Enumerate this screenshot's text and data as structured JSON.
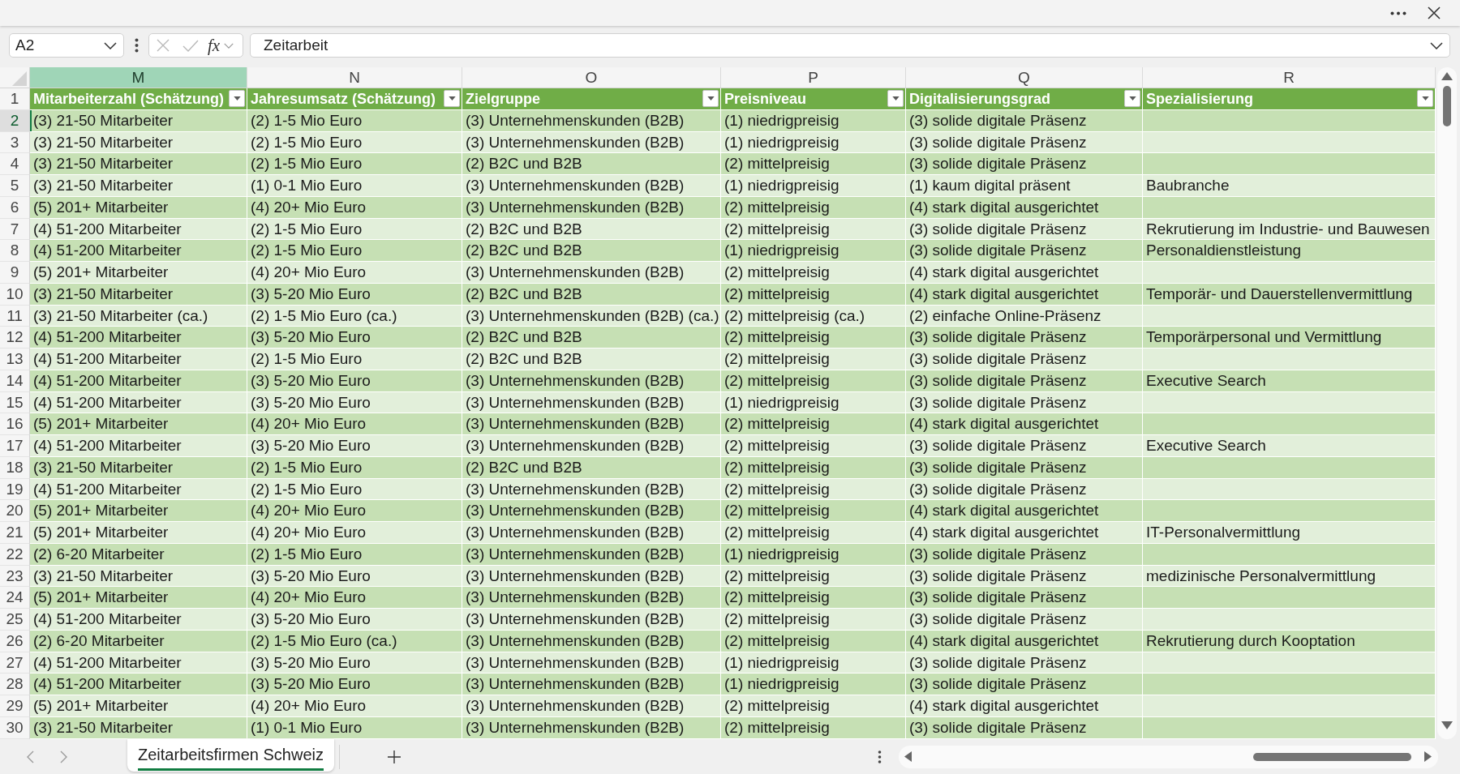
{
  "formula_bar": {
    "name_box": "A2",
    "editing": false,
    "function_label": "fx",
    "formula": "Zeitarbeit"
  },
  "sheet": {
    "columns": [
      {
        "letter": "M",
        "selected": true
      },
      {
        "letter": "N",
        "selected": false
      },
      {
        "letter": "O",
        "selected": false
      },
      {
        "letter": "P",
        "selected": false
      },
      {
        "letter": "Q",
        "selected": false
      },
      {
        "letter": "R",
        "selected": false
      }
    ],
    "rows": [
      {
        "number": "1",
        "kind": "header",
        "selected": false,
        "cells": [
          "Mitarbeiterzahl (Schätzung)",
          "Jahresumsatz (Schätzung)",
          "Zielgruppe",
          "Preisniveau",
          "Digitalisierungsgrad",
          "Spezialisierung"
        ]
      },
      {
        "number": "2",
        "kind": "data",
        "selected": true,
        "cells": [
          "(3) 21-50 Mitarbeiter",
          "(2) 1-5 Mio Euro",
          "(3) Unternehmenskunden (B2B)",
          "(1) niedrigpreisig",
          "(3) solide digitale Präsenz"
        ]
      },
      {
        "number": "3",
        "kind": "data",
        "selected": false,
        "cells": [
          "(3) 21-50 Mitarbeiter",
          "(2) 1-5 Mio Euro",
          "(3) Unternehmenskunden (B2B)",
          "(1) niedrigpreisig",
          "(3) solide digitale Präsenz"
        ]
      },
      {
        "number": "4",
        "kind": "data",
        "selected": false,
        "cells": [
          "(3) 21-50 Mitarbeiter",
          "(2) 1-5 Mio Euro",
          "(2) B2C und B2B",
          "(2) mittelpreisig",
          "(3) solide digitale Präsenz"
        ]
      },
      {
        "number": "5",
        "kind": "data",
        "selected": false,
        "cells": [
          "(3) 21-50 Mitarbeiter",
          "(1) 0-1 Mio Euro",
          "(3) Unternehmenskunden (B2B)",
          "(1) niedrigpreisig",
          "(1) kaum digital präsent",
          "Baubranche"
        ]
      },
      {
        "number": "6",
        "kind": "data",
        "selected": false,
        "cells": [
          "(5) 201+ Mitarbeiter",
          "(4) 20+ Mio Euro",
          "(3) Unternehmenskunden (B2B)",
          "(2) mittelpreisig",
          "(4) stark digital ausgerichtet"
        ]
      },
      {
        "number": "7",
        "kind": "data",
        "selected": false,
        "cells": [
          "(4) 51-200 Mitarbeiter",
          "(2) 1-5 Mio Euro",
          "(2) B2C und B2B",
          "(2) mittelpreisig",
          "(3) solide digitale Präsenz",
          "Rekrutierung im Industrie- und Bauwesen"
        ]
      },
      {
        "number": "8",
        "kind": "data",
        "selected": false,
        "cells": [
          "(4) 51-200 Mitarbeiter",
          "(2) 1-5 Mio Euro",
          "(2) B2C und B2B",
          "(1) niedrigpreisig",
          "(3) solide digitale Präsenz",
          "Personaldienstleistung"
        ]
      },
      {
        "number": "9",
        "kind": "data",
        "selected": false,
        "cells": [
          "(5) 201+ Mitarbeiter",
          "(4) 20+ Mio Euro",
          "(3) Unternehmenskunden (B2B)",
          "(2) mittelpreisig",
          "(4) stark digital ausgerichtet"
        ]
      },
      {
        "number": "10",
        "kind": "data",
        "selected": false,
        "cells": [
          "(3) 21-50 Mitarbeiter",
          "(3) 5-20 Mio Euro",
          "(2) B2C und B2B",
          "(2) mittelpreisig",
          "(4) stark digital ausgerichtet",
          "Temporär- und Dauerstellenvermittlung"
        ]
      },
      {
        "number": "11",
        "kind": "data",
        "selected": false,
        "cells": [
          "(3) 21-50 Mitarbeiter (ca.)",
          "(2) 1-5 Mio Euro (ca.)",
          "(3) Unternehmenskunden (B2B) (ca.)",
          "(2) mittelpreisig (ca.)",
          "(2) einfache Online-Präsenz"
        ]
      },
      {
        "number": "12",
        "kind": "data",
        "selected": false,
        "cells": [
          "(4) 51-200 Mitarbeiter",
          "(3) 5-20 Mio Euro",
          "(2) B2C und B2B",
          "(2) mittelpreisig",
          "(3) solide digitale Präsenz",
          "Temporärpersonal und Vermittlung"
        ]
      },
      {
        "number": "13",
        "kind": "data",
        "selected": false,
        "cells": [
          "(4) 51-200 Mitarbeiter",
          "(2) 1-5 Mio Euro",
          "(2) B2C und B2B",
          "(2) mittelpreisig",
          "(3) solide digitale Präsenz"
        ]
      },
      {
        "number": "14",
        "kind": "data",
        "selected": false,
        "cells": [
          "(4) 51-200 Mitarbeiter",
          "(3) 5-20 Mio Euro",
          "(3) Unternehmenskunden (B2B)",
          "(2) mittelpreisig",
          "(3) solide digitale Präsenz",
          "Executive Search"
        ]
      },
      {
        "number": "15",
        "kind": "data",
        "selected": false,
        "cells": [
          "(4) 51-200 Mitarbeiter",
          "(3) 5-20 Mio Euro",
          "(3) Unternehmenskunden (B2B)",
          "(1) niedrigpreisig",
          "(3) solide digitale Präsenz"
        ]
      },
      {
        "number": "16",
        "kind": "data",
        "selected": false,
        "cells": [
          "(5) 201+ Mitarbeiter",
          "(4) 20+ Mio Euro",
          "(3) Unternehmenskunden (B2B)",
          "(2) mittelpreisig",
          "(4) stark digital ausgerichtet"
        ]
      },
      {
        "number": "17",
        "kind": "data",
        "selected": false,
        "cells": [
          "(4) 51-200 Mitarbeiter",
          "(3) 5-20 Mio Euro",
          "(3) Unternehmenskunden (B2B)",
          "(2) mittelpreisig",
          "(3) solide digitale Präsenz",
          "Executive Search"
        ]
      },
      {
        "number": "18",
        "kind": "data",
        "selected": false,
        "cells": [
          "(3) 21-50 Mitarbeiter",
          "(2) 1-5 Mio Euro",
          "(2) B2C und B2B",
          "(2) mittelpreisig",
          "(3) solide digitale Präsenz"
        ]
      },
      {
        "number": "19",
        "kind": "data",
        "selected": false,
        "cells": [
          "(4) 51-200 Mitarbeiter",
          "(2) 1-5 Mio Euro",
          "(3) Unternehmenskunden (B2B)",
          "(2) mittelpreisig",
          "(3) solide digitale Präsenz"
        ]
      },
      {
        "number": "20",
        "kind": "data",
        "selected": false,
        "cells": [
          "(5) 201+ Mitarbeiter",
          "(4) 20+ Mio Euro",
          "(3) Unternehmenskunden (B2B)",
          "(2) mittelpreisig",
          "(4) stark digital ausgerichtet"
        ]
      },
      {
        "number": "21",
        "kind": "data",
        "selected": false,
        "cells": [
          "(5) 201+ Mitarbeiter",
          "(4) 20+ Mio Euro",
          "(3) Unternehmenskunden (B2B)",
          "(2) mittelpreisig",
          "(4) stark digital ausgerichtet",
          "IT-Personalvermittlung"
        ]
      },
      {
        "number": "22",
        "kind": "data",
        "selected": false,
        "cells": [
          "(2) 6-20 Mitarbeiter",
          "(2) 1-5 Mio Euro",
          "(3) Unternehmenskunden (B2B)",
          "(1) niedrigpreisig",
          "(3) solide digitale Präsenz"
        ]
      },
      {
        "number": "23",
        "kind": "data",
        "selected": false,
        "cells": [
          "(3) 21-50 Mitarbeiter",
          "(3) 5-20 Mio Euro",
          "(3) Unternehmenskunden (B2B)",
          "(2) mittelpreisig",
          "(3) solide digitale Präsenz",
          "medizinische Personalvermittlung"
        ]
      },
      {
        "number": "24",
        "kind": "data",
        "selected": false,
        "cells": [
          "(5) 201+ Mitarbeiter",
          "(4) 20+ Mio Euro",
          "(3) Unternehmenskunden (B2B)",
          "(2) mittelpreisig",
          "(3) solide digitale Präsenz"
        ]
      },
      {
        "number": "25",
        "kind": "data",
        "selected": false,
        "cells": [
          "(4) 51-200 Mitarbeiter",
          "(3) 5-20 Mio Euro",
          "(3) Unternehmenskunden (B2B)",
          "(2) mittelpreisig",
          "(3) solide digitale Präsenz"
        ]
      },
      {
        "number": "26",
        "kind": "data",
        "selected": false,
        "cells": [
          "(2) 6-20 Mitarbeiter",
          "(2) 1-5 Mio Euro (ca.)",
          "(3) Unternehmenskunden (B2B)",
          "(2) mittelpreisig",
          "(4) stark digital ausgerichtet",
          "Rekrutierung durch Kooptation"
        ]
      },
      {
        "number": "27",
        "kind": "data",
        "selected": false,
        "cells": [
          "(4) 51-200 Mitarbeiter",
          "(3) 5-20 Mio Euro",
          "(3) Unternehmenskunden (B2B)",
          "(1) niedrigpreisig",
          "(3) solide digitale Präsenz"
        ]
      },
      {
        "number": "28",
        "kind": "data",
        "selected": false,
        "cells": [
          "(4) 51-200 Mitarbeiter",
          "(3) 5-20 Mio Euro",
          "(3) Unternehmenskunden (B2B)",
          "(1) niedrigpreisig",
          "(3) solide digitale Präsenz"
        ]
      },
      {
        "number": "29",
        "kind": "data",
        "selected": false,
        "cells": [
          "(5) 201+ Mitarbeiter",
          "(4) 20+ Mio Euro",
          "(3) Unternehmenskunden (B2B)",
          "(2) mittelpreisig",
          "(4) stark digital ausgerichtet"
        ]
      },
      {
        "number": "30",
        "kind": "data",
        "selected": false,
        "cells": [
          "(3) 21-50 Mitarbeiter",
          "(1) 0-1 Mio Euro",
          "(3) Unternehmenskunden (B2B)",
          "(2) mittelpreisig",
          "(3) solide digitale Präsenz"
        ]
      }
    ]
  },
  "sheet_tabs": [
    {
      "label": "Zeitarbeitsfirmen Schweiz",
      "selected": true
    }
  ]
}
